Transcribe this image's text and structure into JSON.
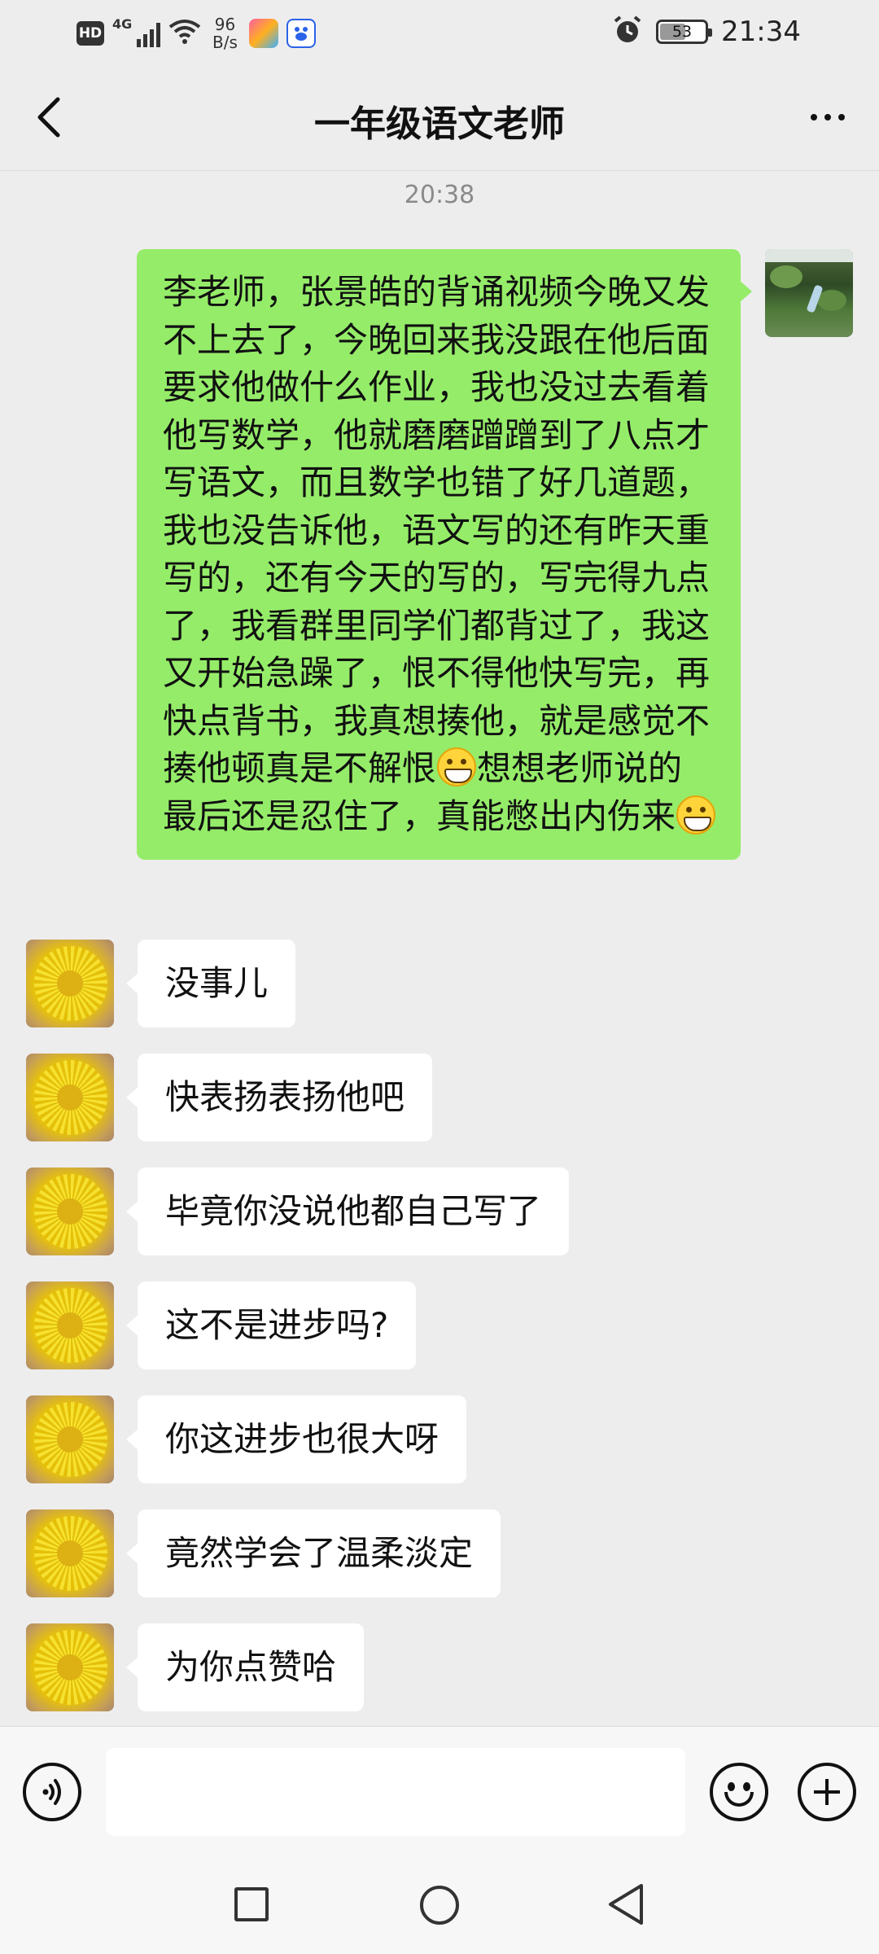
{
  "status_bar": {
    "hd": "HD",
    "network": "4G",
    "speed_value": "96",
    "speed_unit": "B/s",
    "battery": "53",
    "time": "21:34"
  },
  "header": {
    "title": "一年级语文老师"
  },
  "chat": {
    "timestamp": "20:38",
    "sent_message": {
      "parts": [
        "李老师，张景皓的背诵视频今晚又发不上去了，今晚回来我没跟在他后面要求他做什么作业，我也没过去看着他写数学，他就磨磨蹭蹭到了八点才写语文，而且数学也错了好几道题，我也没告诉他，语文写的还有昨天重写的，还有今天的写的，写完得九点了，我看群里同学们都背过了，我这又开始急躁了，恨不得他快写完，再快点背书，我真想揍他，就是感觉不揍他顿真是不解恨",
        "想想老师说的最后还是忍住了，真能憋出内伤来"
      ]
    },
    "received_messages": [
      "没事儿",
      "快表扬表扬他吧",
      "毕竟你没说他都自己写了",
      "这不是进步吗?",
      "你这进步也很大呀",
      "竟然学会了温柔淡定",
      "为你点赞哈"
    ]
  },
  "input": {
    "value": ""
  },
  "colors": {
    "background": "#ededed",
    "sent_bubble": "#95ec69",
    "received_bubble": "#ffffff",
    "timestamp_text": "#8a8a8a"
  },
  "icons": {
    "back": "chevron-left-icon",
    "more": "more-dots-icon",
    "voice": "voice-icon",
    "emoji": "emoji-icon",
    "plus": "plus-icon",
    "recents": "square-icon",
    "home": "circle-icon",
    "sys_back": "triangle-back-icon"
  }
}
